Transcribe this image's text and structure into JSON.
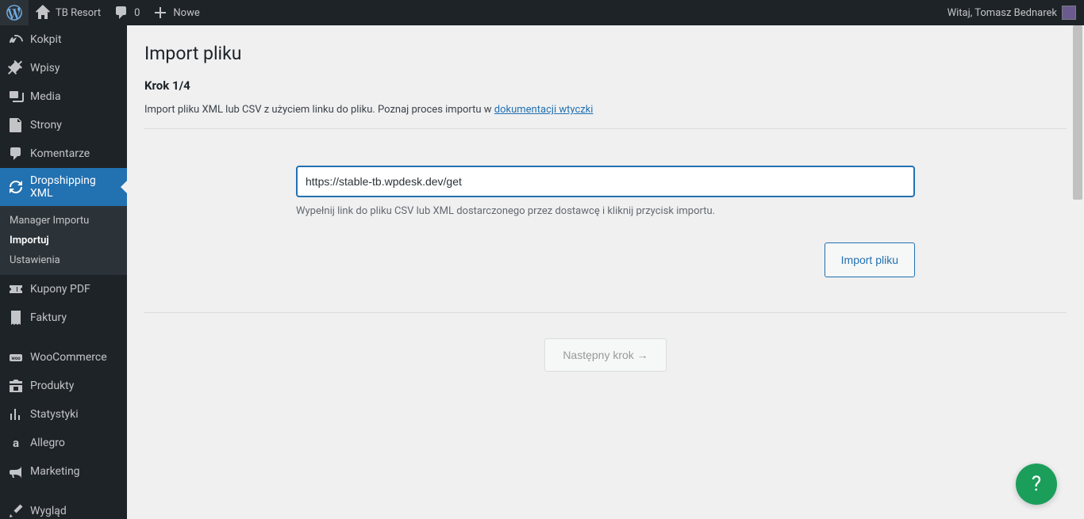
{
  "adminbar": {
    "site_name": "TB Resort",
    "comments_count": "0",
    "new_label": "Nowe",
    "greeting": "Witaj, Tomasz Bednarek"
  },
  "sidebar": {
    "items": [
      {
        "icon": "dashboard",
        "label": "Kokpit"
      },
      {
        "icon": "pin",
        "label": "Wpisy"
      },
      {
        "icon": "media",
        "label": "Media"
      },
      {
        "icon": "page",
        "label": "Strony"
      },
      {
        "icon": "comment",
        "label": "Komentarze"
      },
      {
        "icon": "refresh",
        "label": "Dropshipping XML",
        "active": true,
        "sub": [
          {
            "label": "Manager Importu"
          },
          {
            "label": "Importuj",
            "current": true
          },
          {
            "label": "Ustawienia"
          }
        ]
      },
      {
        "icon": "ticket",
        "label": "Kupony PDF"
      },
      {
        "icon": "invoice",
        "label": "Faktury"
      },
      {
        "sep": true
      },
      {
        "icon": "woo",
        "label": "WooCommerce"
      },
      {
        "icon": "product",
        "label": "Produkty"
      },
      {
        "icon": "stats",
        "label": "Statystyki"
      },
      {
        "icon": "allegro",
        "label": "Allegro"
      },
      {
        "icon": "megaphone",
        "label": "Marketing"
      },
      {
        "sep": true
      },
      {
        "icon": "brush",
        "label": "Wygląd"
      }
    ]
  },
  "page": {
    "title": "Import pliku",
    "step": "Krok 1/4",
    "intro_prefix": "Import pliku XML lub CSV z użyciem linku do pliku. Poznaj proces importu w ",
    "intro_link": "dokumentacji wtyczki",
    "url_value": "https://stable-tb.wpdesk.dev/get",
    "help_text": "Wypełnij link do pliku CSV lub XML dostarczonego przez dostawcę i kliknij przycisk importu.",
    "import_button": "Import pliku",
    "next_button": "Następny krok →",
    "help_fab": "?"
  }
}
